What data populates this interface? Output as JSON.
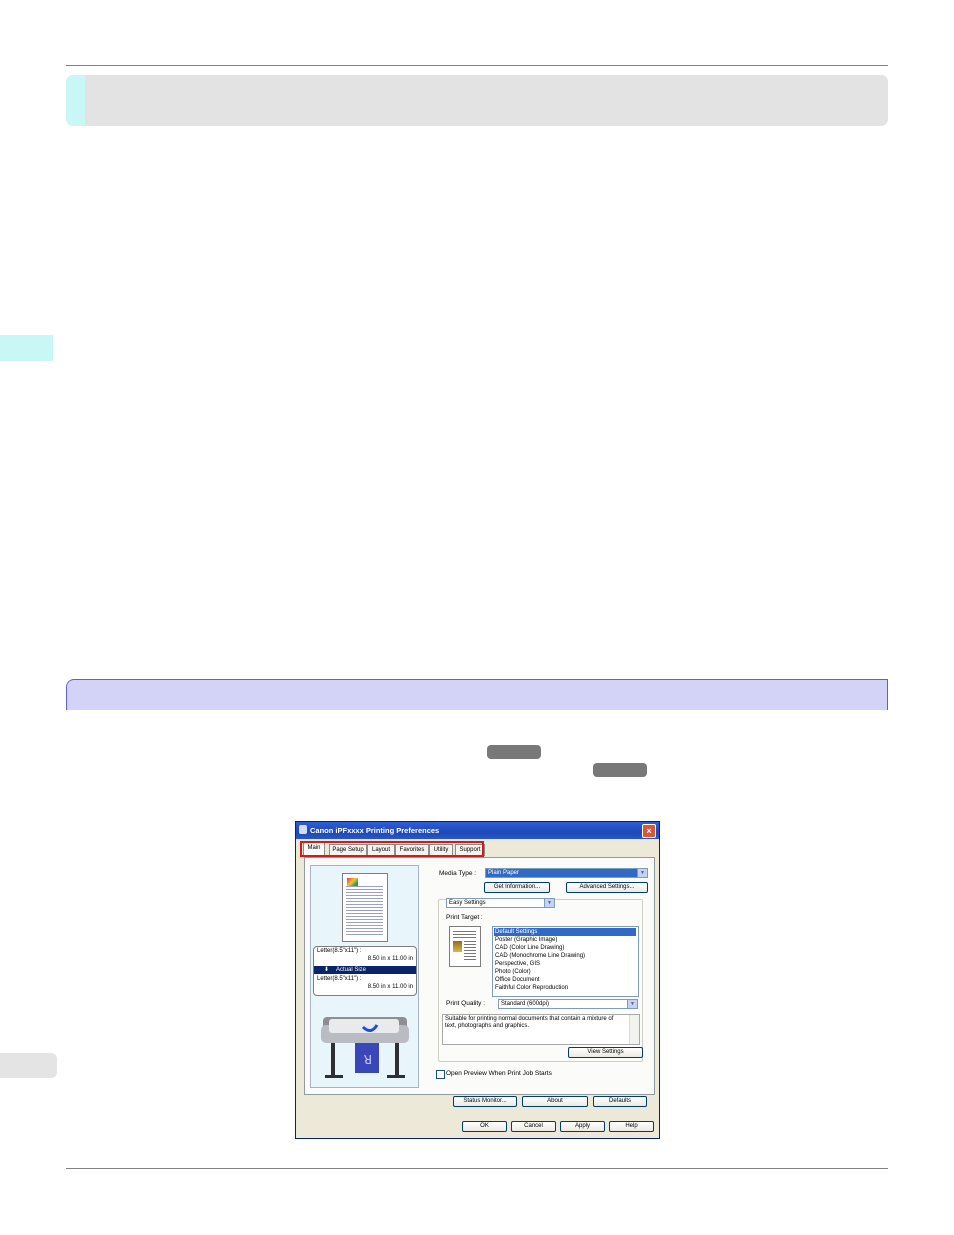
{
  "page": {
    "colors": {
      "rule": "#808080",
      "header_band": "#e3e3e3",
      "accent_cyan": "#c9f7f6",
      "section_band": "#d2d3f6",
      "section_border": "#5c63cf",
      "pill": "#787878",
      "highlight_red": "#d61a1a"
    }
  },
  "dialog": {
    "title": "Canon iPFxxxx Printing Preferences",
    "close_icon": "close-icon",
    "tabs": [
      "Main",
      "Page Setup",
      "Layout",
      "Favorites",
      "Utility",
      "Support"
    ],
    "active_tab": "Main",
    "preview": {
      "size_line1_label": "Letter(8.5\"x11\") :",
      "size_line1_value": "8.50 in x 11.00 in",
      "actual_size": "Actual Size",
      "size_line2_label": "Letter(8.5\"x11\") :",
      "size_line2_value": "8.50 in x 11.00 in"
    },
    "media_type_label": "Media Type :",
    "media_type_value": "Plain Paper",
    "get_information_button": "Get Information...",
    "advanced_settings_button": "Advanced Settings...",
    "settings_mode_value": "Easy Settings",
    "print_target_label": "Print Target :",
    "print_targets": [
      "Default Settings",
      "Poster (Graphic Image)",
      "CAD (Color Line Drawing)",
      "CAD (Monochrome Line Drawing)",
      "Perspective, GIS",
      "Photo (Color)",
      "Office Document",
      "Faithful Color Reproduction"
    ],
    "selected_target_index": 0,
    "print_quality_label": "Print Quality :",
    "print_quality_value": "Standard (600dpi)",
    "description": "Suitable for printing normal documents that contain a mixture of text, photographs and graphics.",
    "view_settings_button": "View Settings",
    "open_preview_label": "Open Preview When Print Job Starts",
    "open_preview_checked": false,
    "status_monitor_button": "Status Monitor...",
    "about_button": "About",
    "defaults_button": "Defaults",
    "ok_button": "OK",
    "cancel_button": "Cancel",
    "apply_button": "Apply",
    "help_button": "Help"
  }
}
